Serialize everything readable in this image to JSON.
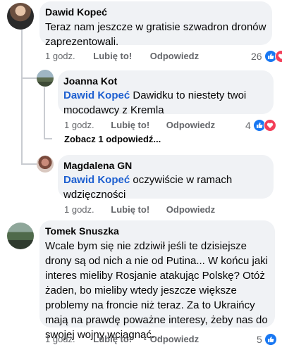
{
  "colors": {
    "accent": "#1d5fd0",
    "like": "#1877f2",
    "love": "#f33e58",
    "bubble": "#f0f2f5",
    "meta": "#65676b"
  },
  "comments": [
    {
      "author": "Dawid Kopeć",
      "text": "Teraz nam jeszcze w gratisie szwadron dronów zaprezentowali.",
      "time": "1 godz.",
      "like_label": "Lubię to!",
      "reply_label": "Odpowiedz",
      "reaction_count": "26",
      "reaction_icons": [
        "like-icon",
        "love-icon"
      ]
    },
    {
      "author": "Joanna Kot",
      "mention": "Dawid Kopeć",
      "text": " Dawidku to niestety twoi mocodawcy  z Kremla",
      "time": "1 godz.",
      "like_label": "Lubię to!",
      "reply_label": "Odpowiedz",
      "reaction_count": "4",
      "reaction_icons": [
        "like-icon",
        "love-icon"
      ]
    },
    {
      "author": "Magdalena GN",
      "mention": "Dawid Kopeć",
      "text": " oczywiście w ramach wdzięczności",
      "time": "1 godz.",
      "like_label": "Lubię to!",
      "reply_label": "Odpowiedz"
    },
    {
      "author": "Tomek Snuszka",
      "text": "Wcale bym się nie zdziwił jeśli te dzisiejsze drony są od nich a nie od Putina... W końcu jaki interes mieliby Rosjanie atakując Polskę? Otóż żaden, bo mieliby wtedy jeszcze większe problemy na froncie niż teraz. Za to Ukraińcy mają na prawdę poważne interesy, żeby nas do swojej wojny wciągnąć...",
      "time": "1 godz.",
      "like_label": "Lubię to!",
      "reply_label": "Odpowiedz",
      "reaction_count": "5",
      "reaction_icons": [
        "like-icon"
      ]
    }
  ],
  "view_replies_label": "Zobacz 1 odpowiedź..."
}
